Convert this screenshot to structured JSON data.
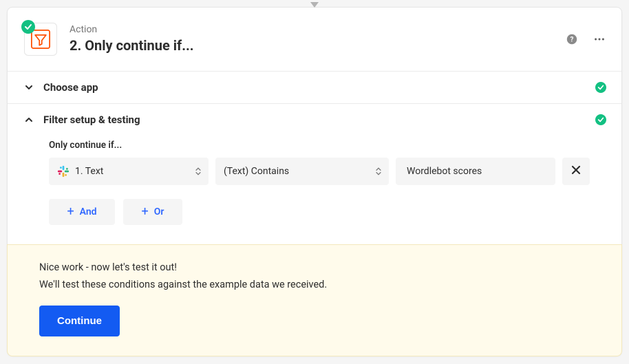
{
  "header": {
    "kicker": "Action",
    "title": "2. Only continue if..."
  },
  "sections": {
    "choose_app": {
      "title": "Choose app"
    },
    "filter_setup": {
      "title": "Filter setup & testing",
      "label": "Only continue if...",
      "condition": {
        "field": "1. Text",
        "operator": "(Text) Contains",
        "value": "Wordlebot scores"
      },
      "logic": {
        "and": "And",
        "or": "Or"
      }
    }
  },
  "footer": {
    "line1": "Nice work - now let's test it out!",
    "line2": "We'll test these conditions against the example data we received.",
    "button": "Continue"
  }
}
